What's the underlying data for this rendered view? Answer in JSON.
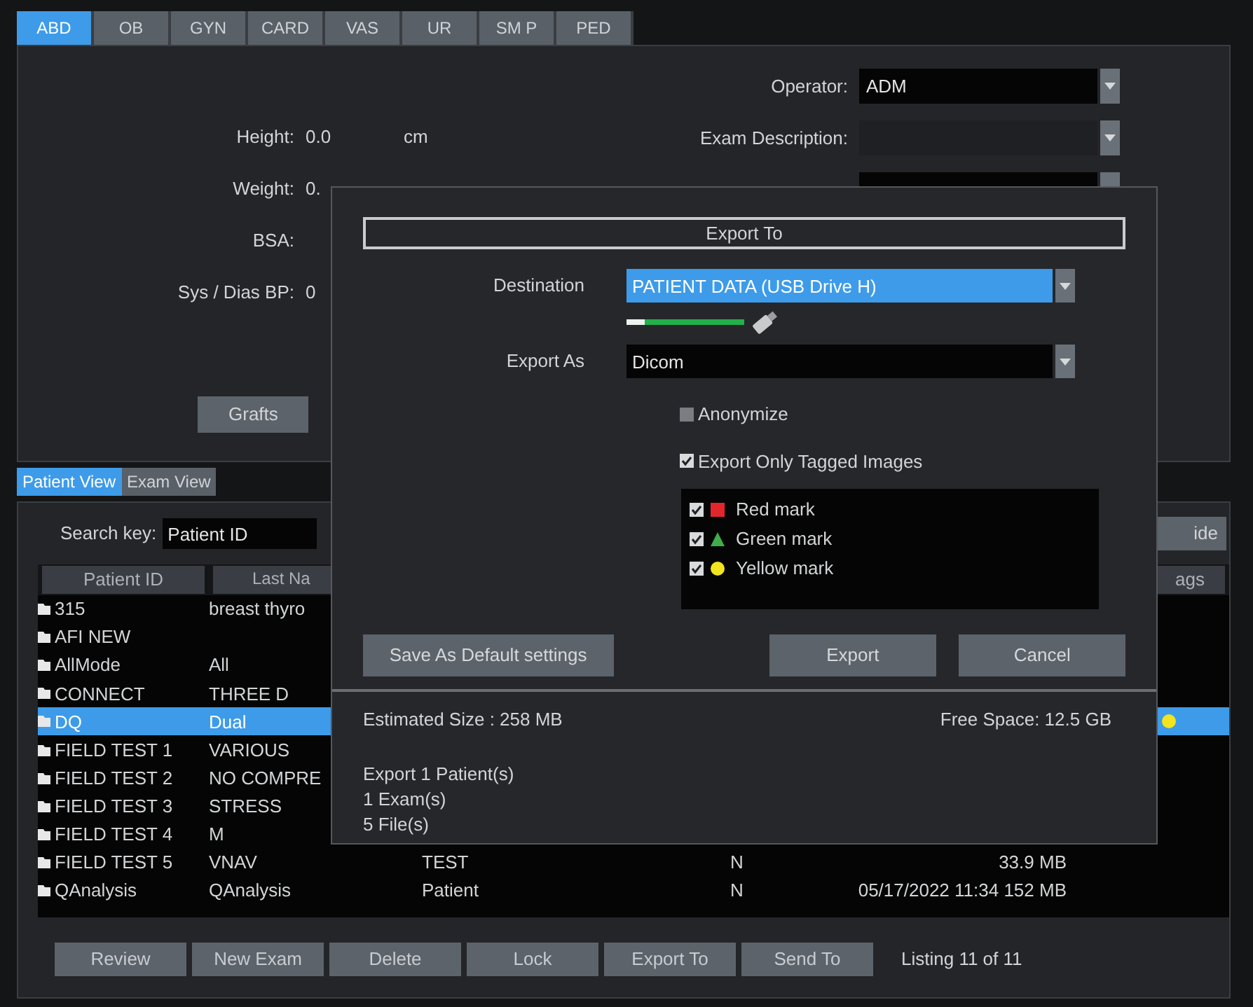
{
  "mode_tabs": [
    {
      "label": "ABD",
      "selected": true
    },
    {
      "label": "OB",
      "selected": false
    },
    {
      "label": "GYN",
      "selected": false
    },
    {
      "label": "CARD",
      "selected": false
    },
    {
      "label": "VAS",
      "selected": false
    },
    {
      "label": "UR",
      "selected": false
    },
    {
      "label": "SM P",
      "selected": false
    },
    {
      "label": "PED",
      "selected": false
    }
  ],
  "patient_fields": [
    {
      "label": "Height:",
      "value": "0.0",
      "unit": "cm"
    },
    {
      "label": "Weight:",
      "value": "0."
    },
    {
      "label": "BSA:"
    },
    {
      "label": "Sys / Dias BP:",
      "value": "0"
    }
  ],
  "grafts_button": "Grafts",
  "exam_fields": [
    {
      "label": "Operator:",
      "value": "ADM"
    },
    {
      "label": "Exam Description:"
    }
  ],
  "view_tabs": [
    {
      "label": "Patient View",
      "selected": true
    },
    {
      "label": "Exam View",
      "selected": false
    }
  ],
  "search": {
    "label": "Search key:",
    "value": "Patient ID"
  },
  "hide_button": "ide",
  "table": {
    "columns": {
      "patient_id": "Patient ID",
      "last_name": "Last Na",
      "tags": "ags"
    },
    "rows": [
      {
        "patient_id": "315",
        "last_name": "breast thyro",
        "selected": false
      },
      {
        "patient_id": "AFI NEW",
        "selected": false
      },
      {
        "patient_id": "AllMode",
        "last_name": "All",
        "selected": false
      },
      {
        "patient_id": "CONNECT",
        "last_name": "THREE D",
        "selected": false
      },
      {
        "patient_id": "DQ",
        "last_name": "Dual",
        "selected": true,
        "color": "#f2e41e"
      },
      {
        "patient_id": "FIELD TEST 1",
        "last_name": "VARIOUS",
        "selected": false
      },
      {
        "patient_id": "FIELD TEST 2",
        "last_name": "NO COMPRE",
        "selected": false
      },
      {
        "patient_id": "FIELD TEST 3",
        "last_name": "STRESS",
        "selected": false
      },
      {
        "patient_id": "FIELD TEST 4",
        "last_name": "M",
        "selected": false
      },
      {
        "patient_id": "FIELD TEST 5",
        "last_name": "VNAV",
        "column_3": "TEST",
        "column_4": "N",
        "column_5": "33.9 MB",
        "selected": false
      },
      {
        "patient_id": "QAnalysis",
        "last_name": "QAnalysis",
        "column_3": "Patient",
        "column_4": "N",
        "column_5": "05/17/2022 11:34 152 MB",
        "selected": false
      }
    ]
  },
  "footer_buttons": [
    "Review",
    "New Exam",
    "Delete",
    "Lock",
    "Export To",
    "Send To"
  ],
  "listing": "Listing 11 of 11",
  "dialog": {
    "title": "Export To",
    "destination_label": "Destination",
    "destination_value": "PATIENT DATA (USB Drive H)",
    "drive_meter": {
      "level": 0.15
    },
    "export_as_label": "Export As",
    "export_as_value": "Dicom",
    "options": [
      {
        "label": "Anonymize",
        "checked": false
      },
      {
        "label": "Export Only Tagged Images",
        "checked": true
      }
    ],
    "marks": [
      {
        "label": "Red mark",
        "checked": true,
        "kind": "square",
        "color": "#e3262b"
      },
      {
        "label": "Green mark",
        "checked": true,
        "kind": "triangle",
        "color": "#3fae4a"
      },
      {
        "label": "Yellow mark",
        "checked": true,
        "kind": "circle",
        "color": "#f2e41e"
      }
    ],
    "buttons": [
      "Save As Default settings",
      "Export",
      "Cancel"
    ],
    "estimated_size": "Estimated Size : 258 MB",
    "free_space": "Free Space: 12.5 GB",
    "summary": [
      "Export 1 Patient(s)",
      "1 Exam(s)",
      "5 File(s)"
    ]
  }
}
